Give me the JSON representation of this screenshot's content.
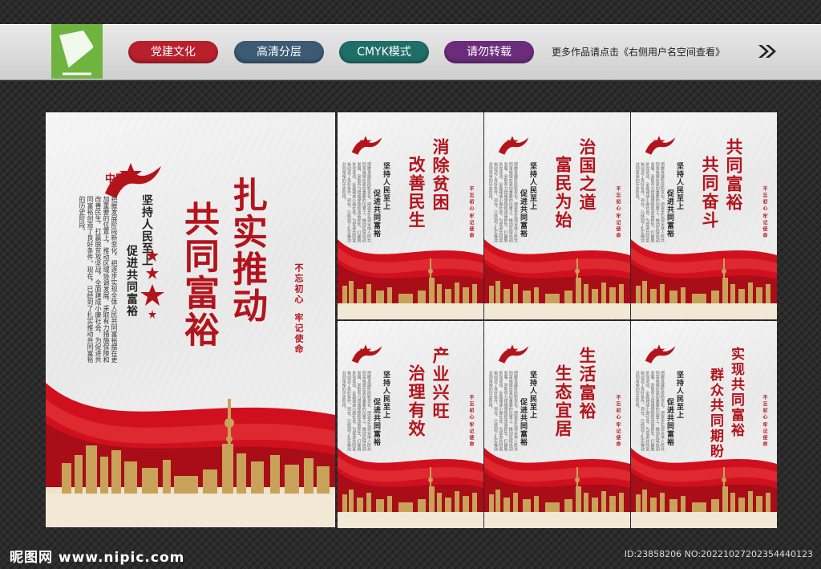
{
  "banner": {
    "tags": [
      "党建文化",
      "高清分层",
      "CMYK模式",
      "请勿转载"
    ],
    "note": "更多作品请点击《右侧用户名空间查看》"
  },
  "logo_text": "中国梦",
  "main_poster": {
    "title_col1": "扎实推动",
    "title_col2": "共同富裕",
    "slogan_col1": "坚持人民至上",
    "slogan_col2": "促进共同富裕",
    "seal_col1": "不忘初心",
    "seal_col2": "牢记使命",
    "body": "把握发展阶段新变化，把逐步实现全体人民共同富裕摆在更加重要的位置上，推动区域协调发展，采取有力措施保障和改善民生，打赢脱贫攻坚战，全面建成小康社会，为促进共同富裕创造了良好条件。现在，已经到了扎实推动共同富裕的历史阶段。"
  },
  "small_posters": [
    {
      "title_col1": "消除贫困",
      "title_col2": "改善民生"
    },
    {
      "title_col1": "治国之道",
      "title_col2": "富民为始"
    },
    {
      "title_col1": "共同富裕",
      "title_col2": "共同奋斗"
    },
    {
      "title_col1": "产业兴旺",
      "title_col2": "治理有效"
    },
    {
      "title_col1": "生活富裕",
      "title_col2": "生态宜居"
    },
    {
      "title_col1": "实现共同富裕",
      "title_col2": "群众共同期盼"
    }
  ],
  "small_slogan": {
    "col1": "坚持人民至上",
    "col2": "促进共同富裕"
  },
  "small_seal": {
    "col1": "不忘初心",
    "col2": "牢记使命"
  },
  "footer": {
    "site": "昵图网 www.nipic.com",
    "id": "ID:23858206 NO:20221027202354440123"
  },
  "colors": {
    "accent_red": "#b3141c",
    "wave_red": "#d0101f",
    "gold": "#c9a25a"
  }
}
